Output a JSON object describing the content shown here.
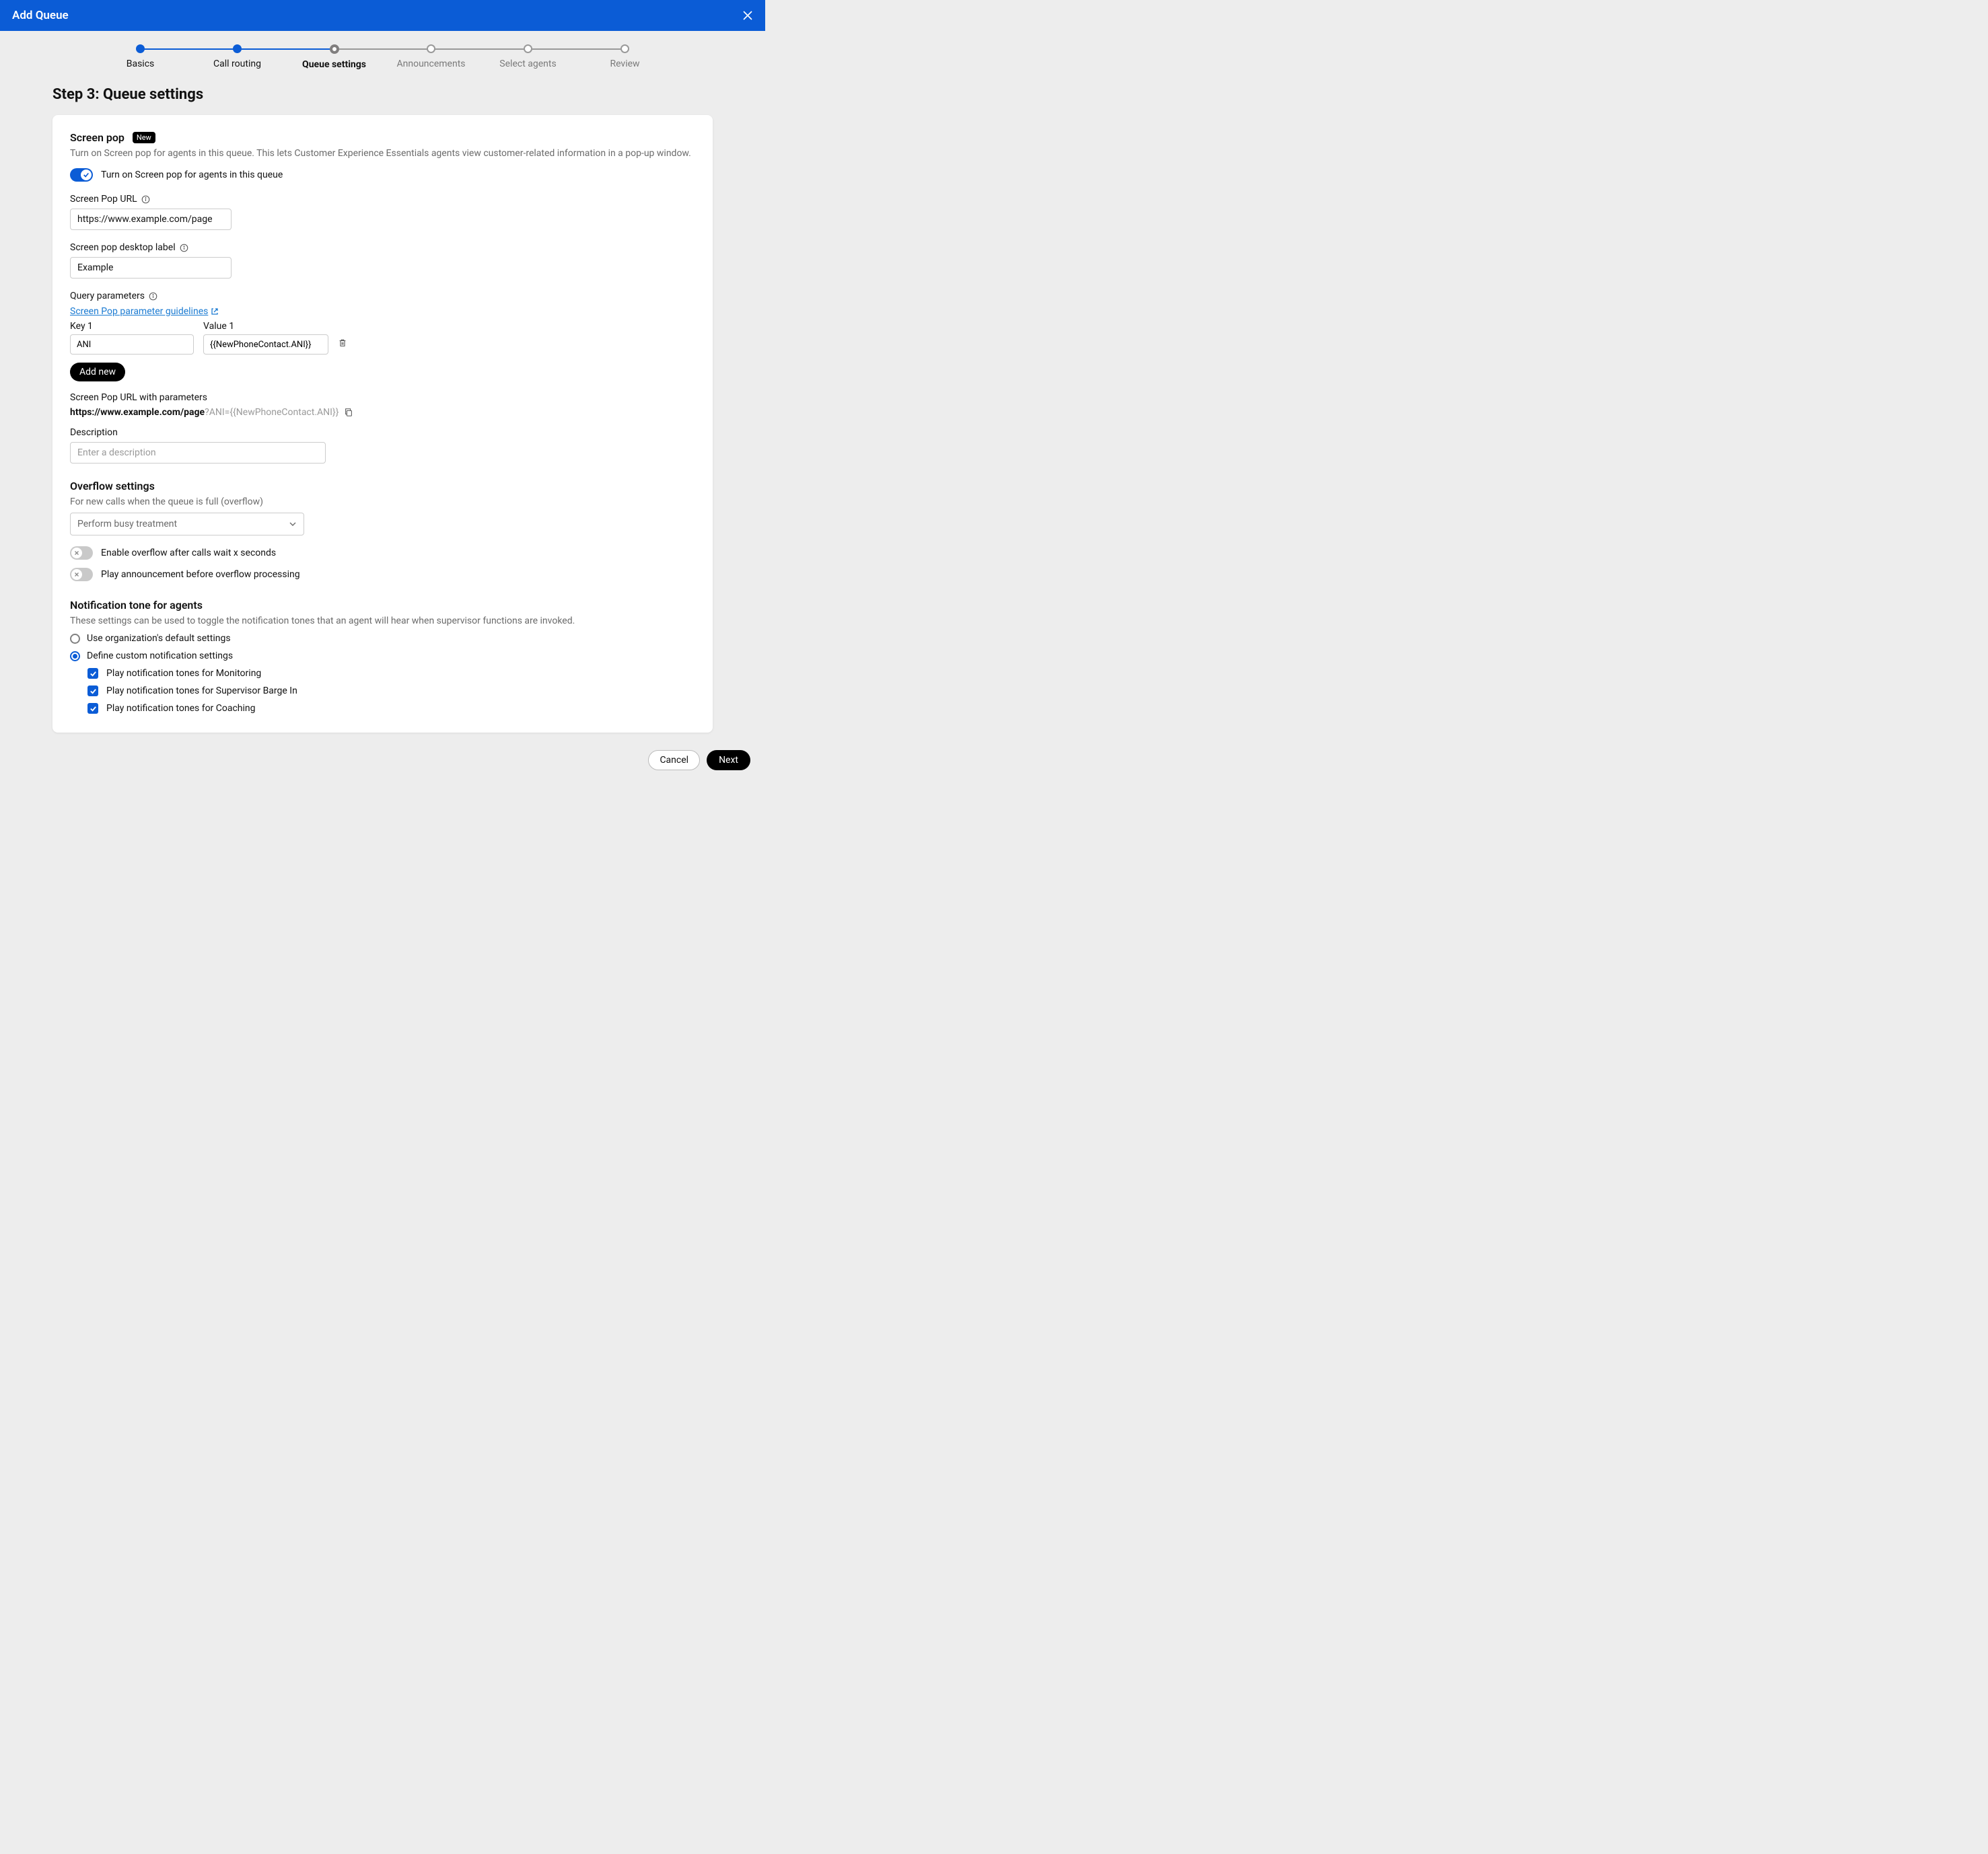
{
  "header": {
    "title": "Add Queue"
  },
  "stepper": {
    "steps": [
      {
        "label": "Basics"
      },
      {
        "label": "Call routing"
      },
      {
        "label": "Queue settings"
      },
      {
        "label": "Announcements"
      },
      {
        "label": "Select agents"
      },
      {
        "label": "Review"
      }
    ]
  },
  "page": {
    "heading": "Step 3: Queue settings"
  },
  "screen_pop": {
    "title": "Screen pop",
    "badge": "New",
    "desc": "Turn on Screen pop for agents in this queue. This lets Customer Experience Essentials agents view customer-related information in a pop-up window.",
    "toggle_label": "Turn on Screen pop for agents in this queue",
    "url_label": "Screen Pop URL",
    "url_value": "https://www.example.com/page",
    "label_label": "Screen pop desktop label",
    "label_value": "Example",
    "query_params_label": "Query parameters",
    "guidelines_link": "Screen Pop parameter guidelines",
    "kv": {
      "key_label": "Key 1",
      "key_value": "ANI",
      "val_label": "Value 1",
      "val_value": "{{NewPhoneContact.ANI}}"
    },
    "add_new": "Add new",
    "url_params_label": "Screen Pop URL with parameters",
    "url_base": "https://www.example.com/page",
    "url_qs": "?ANI={{NewPhoneContact.ANI}}",
    "desc_label": "Description",
    "desc_placeholder": "Enter a description"
  },
  "overflow": {
    "title": "Overflow settings",
    "sub": "For new calls when the queue is full (overflow)",
    "select_value": "Perform busy treatment",
    "t1": "Enable overflow after calls wait x seconds",
    "t2": "Play announcement before overflow processing"
  },
  "notif": {
    "title": "Notification tone for agents",
    "sub": "These settings can be used to toggle the notification tones that an agent will hear when supervisor functions are invoked.",
    "opt1": "Use organization's default settings",
    "opt2": "Define custom notification settings",
    "c1": "Play notification tones for Monitoring",
    "c2": "Play notification tones for Supervisor Barge In",
    "c3": "Play notification tones for Coaching"
  },
  "footer": {
    "cancel": "Cancel",
    "next": "Next"
  }
}
